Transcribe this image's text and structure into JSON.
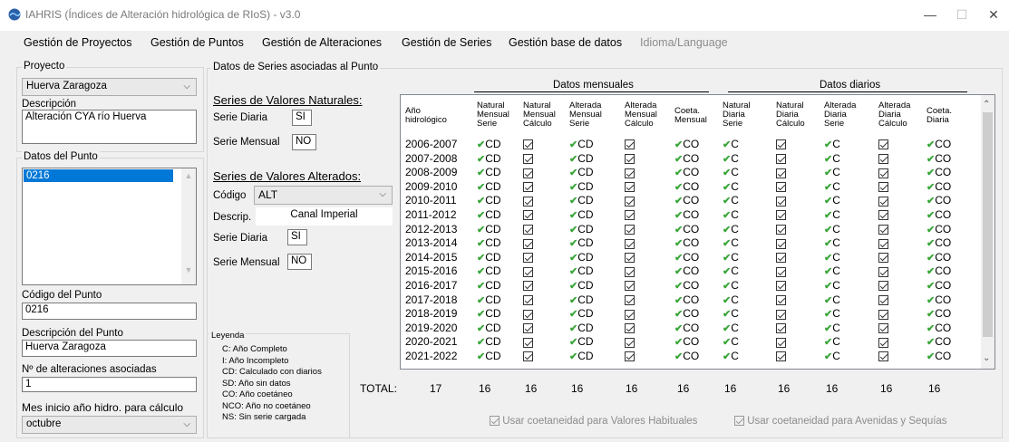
{
  "window": {
    "title": "IAHRIS (Índices de Alteración hidrológica de RIoS) - v3.0",
    "minimize": "—",
    "maximize": "☐",
    "close": "✕"
  },
  "menu": [
    "Gestión de Proyectos",
    "Gestión de Puntos",
    "Gestión de Alteraciones",
    "Gestión de Series",
    "Gestión base de datos",
    "Idioma/Language"
  ],
  "left": {
    "proyecto_title": "Proyecto",
    "proyecto_value": "Huerva Zaragoza",
    "descripcion_label": "Descripción",
    "descripcion_value": "Alteración CYA río Huerva",
    "datos_punto_title": "Datos del Punto",
    "punto_list": [
      "0216"
    ],
    "codigo_label": "Código del Punto",
    "codigo_value": "0216",
    "desc_punto_label": "Descripción del Punto",
    "desc_punto_value": "Huerva Zaragoza",
    "nalt_label": "Nº de alteraciones asociadas",
    "nalt_value": "1",
    "mes_label": "Mes inicio año hidro. para cálculo",
    "mes_value": "octubre"
  },
  "series": {
    "group_title": "Datos de Series asociadas al Punto",
    "naturales_title": "Series de Valores Naturales:",
    "nat_diaria_label": "Serie Diaria",
    "nat_diaria_value": "SI",
    "nat_mensual_label": "Serie Mensual",
    "nat_mensual_value": "NO",
    "alterados_title": "Series de Valores Alterados:",
    "codigo_label": "Código",
    "codigo_value": "ALT",
    "descrip_label": "Descrip.",
    "descrip_value": "Canal Imperial",
    "alt_diaria_label": "Serie Diaria",
    "alt_diaria_value": "SI",
    "alt_mensual_label": "Serie Mensual",
    "alt_mensual_value": "NO"
  },
  "legend": {
    "title": "Leyenda",
    "items": [
      "C: Año Completo",
      "I: Año Incompleto",
      "CD: Calculado con diarios",
      "SD: Año sin datos",
      "CO: Año coetáneo",
      "NCO: Año no coetáneo",
      "NS: Sin serie cargada"
    ]
  },
  "grid": {
    "group_mensuales": "Datos mensuales",
    "group_diarios": "Datos diarios",
    "headers": [
      [
        "Año",
        "hidrológico"
      ],
      [
        "Natural",
        "Mensual",
        "Serie"
      ],
      [
        "Natural",
        "Mensual",
        "Cálculo"
      ],
      [
        "Alterada",
        "Mensual",
        "Serie"
      ],
      [
        "Alterada",
        "Mensual",
        "Cálculo"
      ],
      [
        "Coeta.",
        "Mensual"
      ],
      [
        "Natural",
        "Diaria",
        "Serie"
      ],
      [
        "Natural",
        "Diaria",
        "Cálculo"
      ],
      [
        "Alterada",
        "Diaria",
        "Serie"
      ],
      [
        "Alterada",
        "Diaria",
        "Cálculo"
      ],
      [
        "Coeta.",
        "Diaria"
      ]
    ],
    "years": [
      "2006-2007",
      "2007-2008",
      "2008-2009",
      "2009-2010",
      "2010-2011",
      "2011-2012",
      "2012-2013",
      "2013-2014",
      "2014-2015",
      "2015-2016",
      "2016-2017",
      "2017-2018",
      "2018-2019",
      "2019-2020",
      "2020-2021",
      "2021-2022"
    ],
    "row_values": [
      "CD",
      "",
      "CD",
      "",
      "CO",
      "C",
      "",
      "C",
      "",
      "CO"
    ],
    "row_kinds": [
      "ok",
      "cb",
      "ok",
      "cb",
      "ok",
      "ok",
      "cb",
      "ok",
      "cb",
      "ok"
    ],
    "total_label": "TOTAL:",
    "totals": [
      "17",
      "16",
      "16",
      "16",
      "16",
      "16",
      "16",
      "16",
      "16",
      "16",
      "16"
    ]
  },
  "options": {
    "habituales": "Usar coetaneidad para Valores Habituales",
    "avenidas": "Usar coetaneidad para Avenidas y Sequías"
  }
}
